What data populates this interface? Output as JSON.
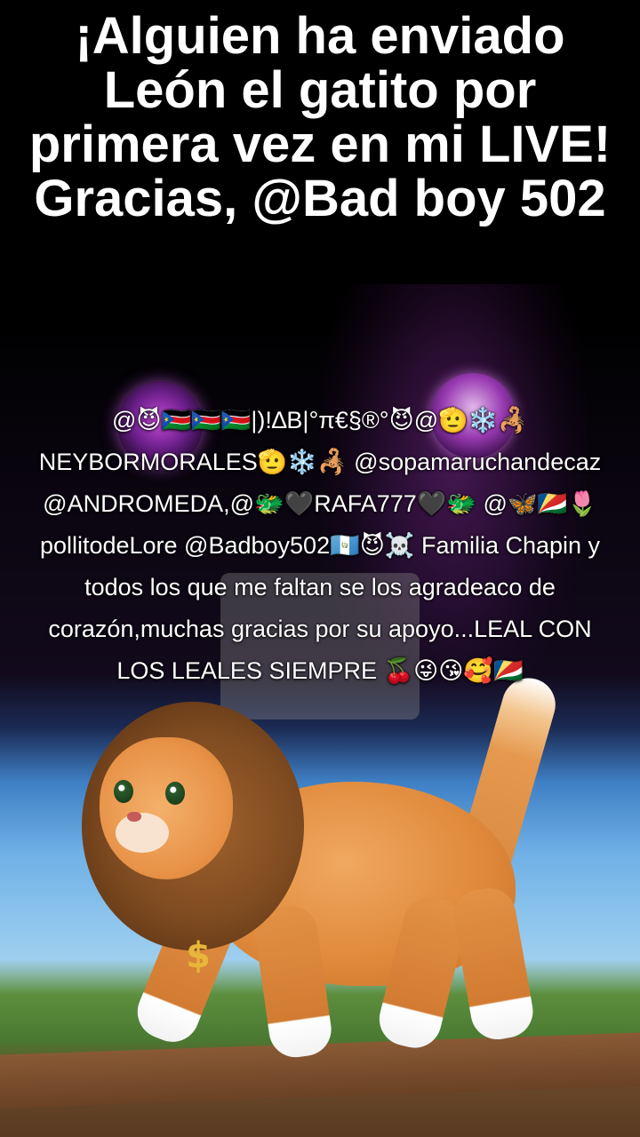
{
  "overlay": {
    "title": "¡Alguien ha enviado León el gatito por primera vez en mi LIVE! Gracias, @Bad boy 502",
    "caption": "@😈🇸🇸🇸🇸🇸🇸|)!∆B|°π€§®°😈@🫡❄️🦂 NEYBORMORALES🫡❄️🦂 @sopamaruchandecaz @ANDROMEDA,@🐲🖤RAFA777🖤🐲 @🦋🇸🇨🌷pollitodeLore @Badboy502🇬🇹😈☠️  Familia Chapin y todos los que me faltan se los agradeaco de corazón,muchas gracias por su apoyo...LEAL CON LOS LEALES SIEMPRE 🍒😜😘🥰🇸🇨"
  },
  "scene": {
    "pendant_glyph": "$"
  }
}
